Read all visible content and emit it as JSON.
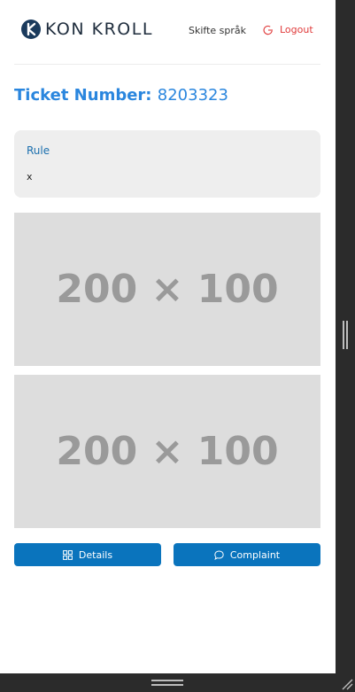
{
  "header": {
    "logo_text": "KON KROLL",
    "language_label": "Skifte språk",
    "logout_label": "Logout"
  },
  "ticket": {
    "title_label": "Ticket Number:",
    "number": "8203323"
  },
  "rule": {
    "label": "Rule",
    "value": "x"
  },
  "images": [
    {
      "placeholder_text": "200 × 100"
    },
    {
      "placeholder_text": "200 × 100"
    }
  ],
  "actions": {
    "details_label": "Details",
    "complaint_label": "Complaint"
  },
  "colors": {
    "accent": "#2a86de",
    "button": "#0a74bd",
    "logout": "#e03a3a",
    "card": "#eeeeee",
    "placeholder": "#dddddd"
  },
  "icons": {
    "logo": "konkroll-logo-icon",
    "logout": "logout-icon",
    "details": "grid-icon",
    "complaint": "chat-icon"
  }
}
